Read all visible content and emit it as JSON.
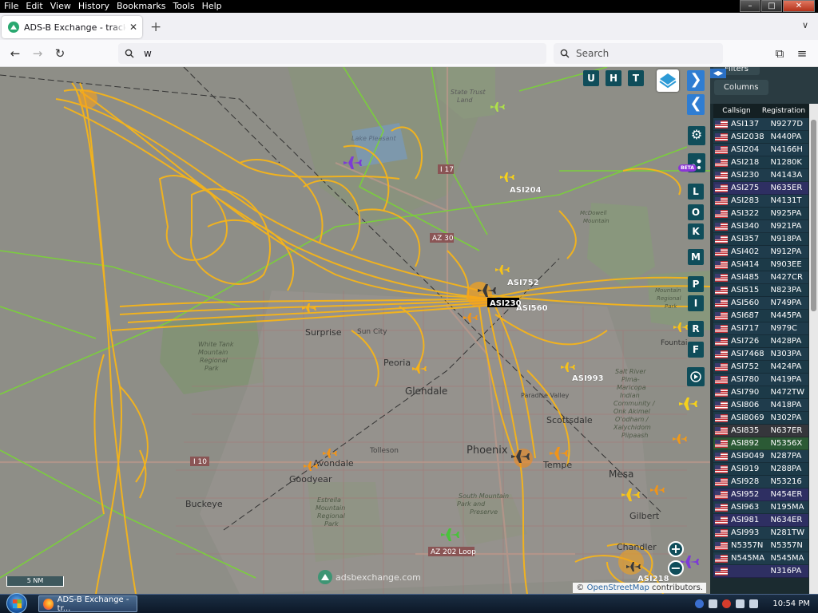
{
  "menubar": {
    "items": [
      "File",
      "Edit",
      "View",
      "History",
      "Bookmarks",
      "Tools",
      "Help"
    ],
    "accelerators": [
      "F",
      "E",
      "V",
      "H",
      "B",
      "T",
      "H"
    ]
  },
  "window_controls": {
    "minimize": "–",
    "maximize": "□",
    "close": "✕"
  },
  "browser": {
    "tab_title": "ADS-B Exchange - track aircraft",
    "tab_close": "✕",
    "new_tab": "+",
    "tab_list": "∨",
    "back": "←",
    "forward": "→",
    "reload": "↻",
    "url": "w",
    "search_placeholder": "Search",
    "extensions": "⧉",
    "menu": "≡"
  },
  "map": {
    "place_labels": [
      "State Trust Land",
      "Lake Pleasant",
      "I 17",
      "AZ 30",
      "McDowell Mountain",
      "Surprise",
      "Sun City",
      "White Tank Mountain Regional Park",
      "Peoria",
      "Glendale",
      "Paradise Valley",
      "Scottsdale",
      "Salt River Pima-Maricopa Indian Community / Onk Akimel O'odham / Xalychidom Piipaash",
      "Tolleson",
      "I 10",
      "Avondale",
      "Goodyear",
      "Phoenix",
      "Tempe",
      "Mesa",
      "Buckeye",
      "Estrella Mountain Regional Park",
      "South Mountain Park and Preserve",
      "Gilbert",
      "AZ 202 Loop",
      "Chandler",
      "Mountain Regional Park",
      "Fountain"
    ],
    "aircraft_labels": [
      "ASI204",
      "ASI752",
      "ASI230",
      "ASI560",
      "ASI993",
      "ASI218"
    ],
    "toolbar_letters": [
      "U",
      "H",
      "T"
    ],
    "side_letters": [
      "L",
      "O",
      "K",
      "M",
      "P",
      "I",
      "R",
      "F"
    ],
    "settings_icon": "⚙",
    "beta_label": "BETA",
    "next_arrow": "❯",
    "prev_arrow": "❮",
    "zoom_in": "+",
    "zoom_out": "−",
    "scale_label": "5 NM",
    "watermark": "adsbexchange.com",
    "attribution_prefix": "©",
    "attribution_link": "OpenStreetMap",
    "attribution_suffix": "contributors.",
    "track_color": "#f6b41a",
    "track_color_green": "#7ad13a"
  },
  "panel": {
    "filters_label": "Filters",
    "columns_label": "Columns",
    "collapse_label": "◀▶",
    "headers": {
      "callsign": "Callsign",
      "registration": "Registration"
    },
    "rows": [
      {
        "callsign": "ASI137",
        "reg": "N9277D",
        "bg": "#1f3c4c"
      },
      {
        "callsign": "ASI2038",
        "reg": "N440PA",
        "bg": "#1c3a48"
      },
      {
        "callsign": "ASI204",
        "reg": "N4166H",
        "bg": "#1f3c4c"
      },
      {
        "callsign": "ASI218",
        "reg": "N1280K",
        "bg": "#1c3a48"
      },
      {
        "callsign": "ASI230",
        "reg": "N4143A",
        "bg": "#1f3c4c"
      },
      {
        "callsign": "ASI275",
        "reg": "N635ER",
        "bg": "#2e2f62"
      },
      {
        "callsign": "ASI283",
        "reg": "N4131T",
        "bg": "#1f3c4c"
      },
      {
        "callsign": "ASI322",
        "reg": "N925PA",
        "bg": "#1c3a48"
      },
      {
        "callsign": "ASI340",
        "reg": "N921PA",
        "bg": "#1f3c4c"
      },
      {
        "callsign": "ASI357",
        "reg": "N918PA",
        "bg": "#1c3a48"
      },
      {
        "callsign": "ASI402",
        "reg": "N912PA",
        "bg": "#1f3c4c"
      },
      {
        "callsign": "ASI414",
        "reg": "N903EE",
        "bg": "#1c3a48"
      },
      {
        "callsign": "ASI485",
        "reg": "N427CR",
        "bg": "#1f3c4c"
      },
      {
        "callsign": "ASI515",
        "reg": "N823PA",
        "bg": "#1c3a48"
      },
      {
        "callsign": "ASI560",
        "reg": "N749PA",
        "bg": "#1f3c4c"
      },
      {
        "callsign": "ASI687",
        "reg": "N445PA",
        "bg": "#1c3a48"
      },
      {
        "callsign": "ASI717",
        "reg": "N979C",
        "bg": "#1f3c4c"
      },
      {
        "callsign": "ASI726",
        "reg": "N428PA",
        "bg": "#1c3a48"
      },
      {
        "callsign": "ASI7468",
        "reg": "N303PA",
        "bg": "#1f3c4c"
      },
      {
        "callsign": "ASI752",
        "reg": "N424PA",
        "bg": "#1c3a48"
      },
      {
        "callsign": "ASI780",
        "reg": "N419PA",
        "bg": "#1f3c4c"
      },
      {
        "callsign": "ASI790",
        "reg": "N472TW",
        "bg": "#1c3a48"
      },
      {
        "callsign": "ASI806",
        "reg": "N418PA",
        "bg": "#1f3c4c"
      },
      {
        "callsign": "ASI8069",
        "reg": "N302PA",
        "bg": "#1c3a48"
      },
      {
        "callsign": "ASI835",
        "reg": "N637ER",
        "bg": "#35363b"
      },
      {
        "callsign": "ASI892",
        "reg": "N5356X",
        "bg": "#2b5a35"
      },
      {
        "callsign": "ASI9049",
        "reg": "N287PA",
        "bg": "#1f3c4c"
      },
      {
        "callsign": "ASI919",
        "reg": "N288PA",
        "bg": "#1c3a48"
      },
      {
        "callsign": "ASI928",
        "reg": "N53216",
        "bg": "#1f3c4c"
      },
      {
        "callsign": "ASI952",
        "reg": "N454ER",
        "bg": "#2e2f62"
      },
      {
        "callsign": "ASI963",
        "reg": "N195MA",
        "bg": "#1f3c4c"
      },
      {
        "callsign": "ASI981",
        "reg": "N634ER",
        "bg": "#2e2f62"
      },
      {
        "callsign": "ASI993",
        "reg": "N281TW",
        "bg": "#1f3c4c"
      },
      {
        "callsign": "N5357N",
        "reg": "N5357N",
        "bg": "#1c3a48"
      },
      {
        "callsign": "N545MA",
        "reg": "N545MA",
        "bg": "#1f3c4c"
      },
      {
        "callsign": "",
        "reg": "N316PA",
        "bg": "#2e2f62"
      }
    ]
  },
  "taskbar": {
    "firefox_task_label": "ADS-B Exchange - tr...",
    "clock": "10:54 PM"
  }
}
